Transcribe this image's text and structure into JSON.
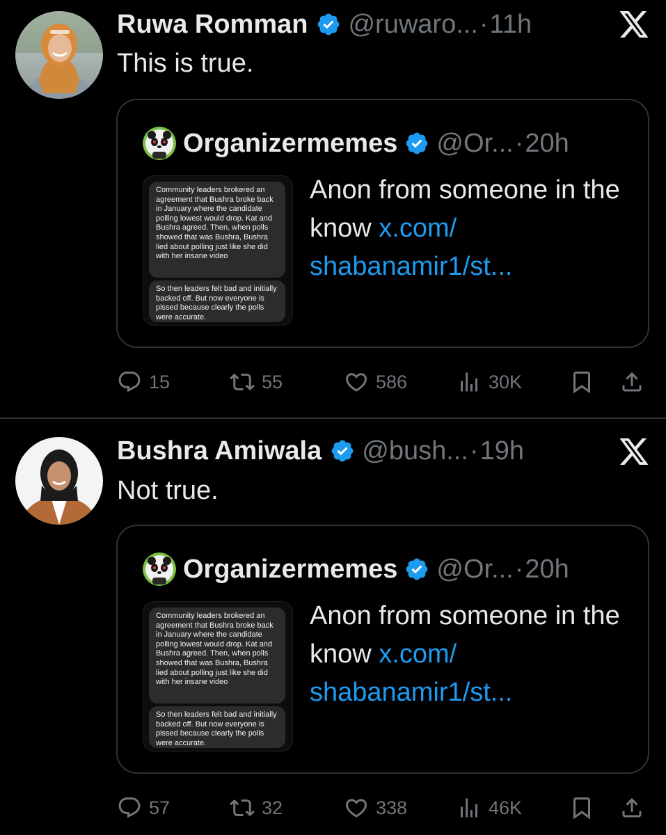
{
  "tweets": [
    {
      "author": {
        "name": "Ruwa Romman",
        "handle": "@ruwaro...",
        "time": "11h",
        "dot": "·"
      },
      "text": "This is true.",
      "quote": {
        "author": {
          "name": "Organizermemes",
          "handle": "@Or...",
          "time": "20h",
          "dot": "·"
        },
        "text": "Anon from someone in the know ",
        "link": "x.com/ shabanamir1/st...",
        "image": {
          "bubble1": "Community leaders brokered an agreement that Bushra broke back in January where the candidate polling lowest would drop. Kat and Bushra agreed. Then, when polls showed that was Bushra, Bushra lied about polling just like she did with her insane video",
          "bubble2": "So then leaders felt bad and initially backed off. But now everyone is pissed because clearly the polls were accurate."
        }
      },
      "stats": {
        "replies": "15",
        "retweets": "55",
        "likes": "586",
        "views": "30K"
      }
    },
    {
      "author": {
        "name": "Bushra Amiwala",
        "handle": "@bush...",
        "time": "19h",
        "dot": "·"
      },
      "text": "Not true.",
      "quote": {
        "author": {
          "name": "Organizermemes",
          "handle": "@Or...",
          "time": "20h",
          "dot": "·"
        },
        "text": "Anon from someone in the know ",
        "link": "x.com/ shabanamir1/st...",
        "image": {
          "bubble1": "Community leaders brokered an agreement that Bushra broke back in January where the candidate polling lowest would drop. Kat and Bushra agreed. Then, when polls showed that was Bushra, Bushra lied about polling just like she did with her insane video",
          "bubble2": "So then leaders felt bad and initially backed off. But now everyone is pissed because clearly the polls were accurate."
        }
      },
      "stats": {
        "replies": "57",
        "retweets": "32",
        "likes": "338",
        "views": "46K"
      }
    }
  ],
  "icons": {
    "verified": "verified-badge-icon",
    "platform": "x-logo-icon",
    "reply": "reply-icon",
    "retweet": "retweet-icon",
    "like": "heart-icon",
    "views": "views-icon",
    "bookmark": "bookmark-icon",
    "share": "share-icon"
  },
  "colors": {
    "background": "#000000",
    "text": "#e7e9ea",
    "secondary": "#71767b",
    "link": "#1d9bf0",
    "verified": "#1d9bf0",
    "border": "#2f3336"
  }
}
